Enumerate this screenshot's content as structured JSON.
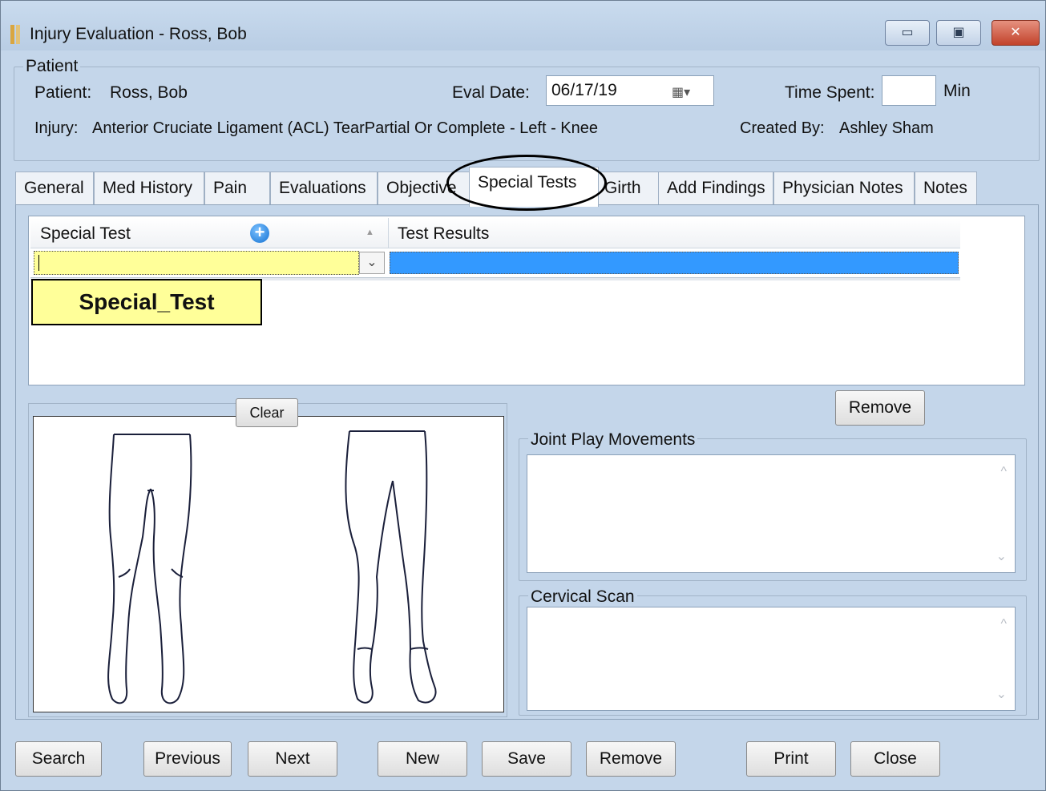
{
  "window": {
    "title": "Injury Evaluation - Ross, Bob",
    "controls": {
      "minimize": "▭",
      "maximize": "▣",
      "close": "✕"
    }
  },
  "patient_group": {
    "legend": "Patient",
    "patient_label": "Patient:",
    "patient_value": "Ross, Bob",
    "eval_date_label": "Eval Date:",
    "eval_date_value": "06/17/19",
    "time_spent_label": "Time Spent:",
    "time_spent_value": "",
    "time_unit": "Min",
    "injury_label": "Injury:",
    "injury_value": "Anterior Cruciate Ligament (ACL) TearPartial Or Complete - Left - Knee",
    "created_by_label": "Created By:",
    "created_by_value": "Ashley Sham"
  },
  "tabs": [
    {
      "label": "General"
    },
    {
      "label": "Med History"
    },
    {
      "label": "Pain"
    },
    {
      "label": "Evaluations"
    },
    {
      "label": "Objective"
    },
    {
      "label": "Special Tests"
    },
    {
      "label": "Girth"
    },
    {
      "label": "Add Findings"
    },
    {
      "label": "Physician Notes"
    },
    {
      "label": "Notes"
    }
  ],
  "active_tab": "Special Tests",
  "grid": {
    "columns": [
      "Special Test",
      "Test Results"
    ],
    "rows": [
      {
        "special_test": "",
        "test_results": ""
      }
    ]
  },
  "callout": "Special_Test",
  "body_diagram": {
    "clear_label": "Clear"
  },
  "remove_label": "Remove",
  "joint_play": {
    "legend": "Joint Play Movements",
    "value": ""
  },
  "cervical_scan": {
    "legend": "Cervical Scan",
    "value": ""
  },
  "bottom_buttons": {
    "search": "Search",
    "previous": "Previous",
    "next": "Next",
    "new": "New",
    "save": "Save",
    "remove": "Remove",
    "print": "Print",
    "close": "Close"
  },
  "colors": {
    "background": "#c4d6ea",
    "selected_cell": "#ffff99",
    "selected_row": "#3399ff",
    "close_button": "#c2422b"
  }
}
